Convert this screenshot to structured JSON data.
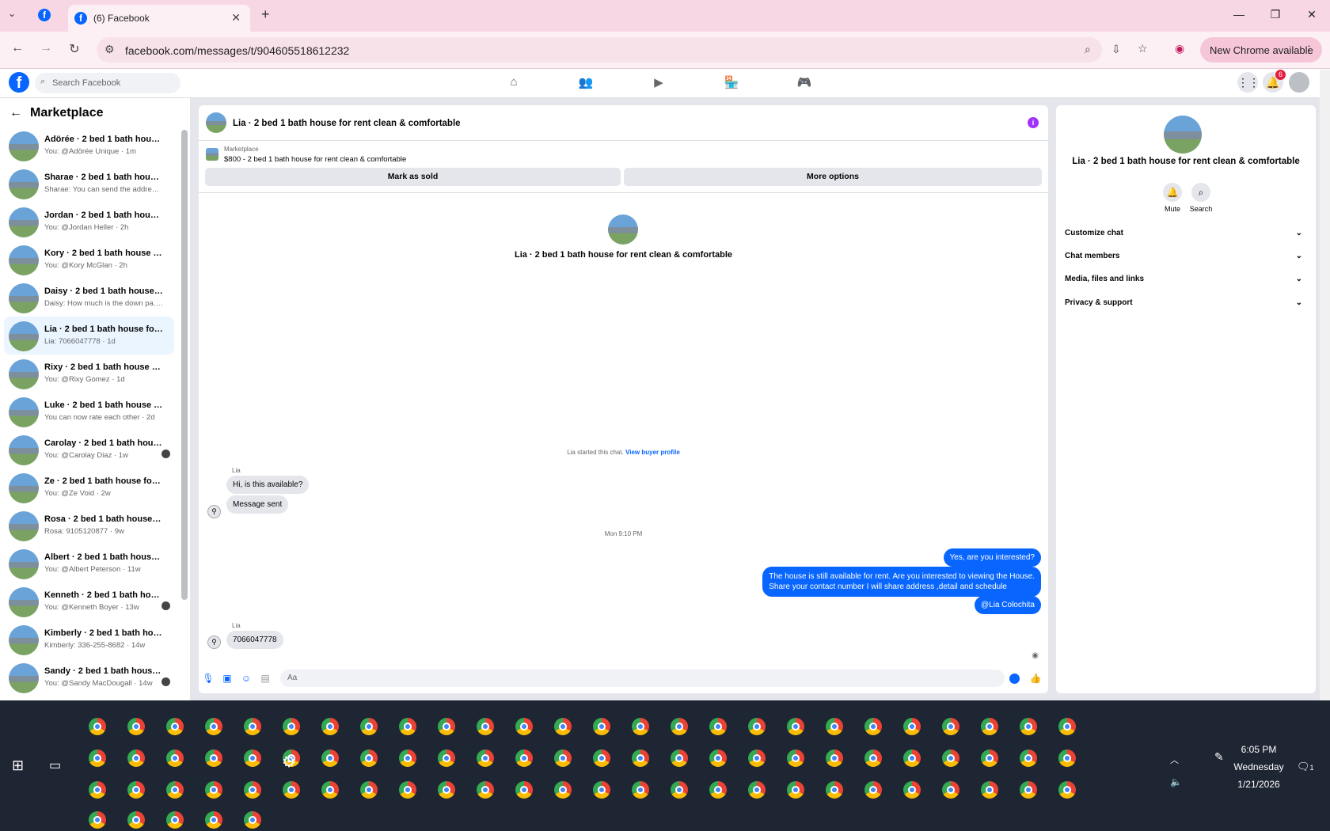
{
  "browser": {
    "tab_title": "(6) Facebook",
    "url": "facebook.com/messages/t/904605518612232",
    "new_chrome": "New Chrome available"
  },
  "fb": {
    "search_placeholder": "Search Facebook",
    "notification_count": "6"
  },
  "sidebar": {
    "title": "Marketplace",
    "conversations": [
      {
        "name": "Adörée · 2 bed 1 bath house fo...",
        "preview": "You: @Adörée Unique · 1m"
      },
      {
        "name": "Sharae · 2 bed 1 bath house for...",
        "preview": "Sharae: You can send the address ... · 2h"
      },
      {
        "name": "Jordan · 2 bed 1 bath house for...",
        "preview": "You: @Jordan Heller · 2h"
      },
      {
        "name": "Kory · 2 bed 1 bath house for r...",
        "preview": "You: @Kory McGlan · 2h"
      },
      {
        "name": "Daisy · 2 bed 1 bath house for r...",
        "preview": "Daisy: How much is the down pa... · 17h"
      },
      {
        "name": "Lia · 2 bed 1 bath house for ren...",
        "preview": "Lia: 7066047778 · 1d"
      },
      {
        "name": "Rixy · 2 bed 1 bath house for re...",
        "preview": "You: @Rixy Gomez · 1d"
      },
      {
        "name": "Luke · 2 bed 1 bath house for r...",
        "preview": "You can now rate each other · 2d"
      },
      {
        "name": "Carolay · 2 bed 1 bath house ...",
        "preview": "You: @Carolay Diaz · 1w"
      },
      {
        "name": "Ze · 2 bed 1 bath house for rent...",
        "preview": "You: @Ze Void · 2w"
      },
      {
        "name": "Rosa · 2 bed 1 bath house for r...",
        "preview": "Rosa: 9105120877 · 9w"
      },
      {
        "name": "Albert · 2 bed 1 bath house for ...",
        "preview": "You: @Albert Peterson · 11w"
      },
      {
        "name": "Kenneth · 2 bed 1 bath house...",
        "preview": "You: @Kenneth Boyer · 13w"
      },
      {
        "name": "Kimberly · 2 bed 1 bath house f...",
        "preview": "Kimberly: 336-255-8682 · 14w"
      },
      {
        "name": "Sandy · 2 bed 1 bath house f...",
        "preview": "You: @Sandy MacDougall · 14w"
      }
    ]
  },
  "chat": {
    "title": "Lia · 2 bed 1 bath house for rent clean & comfortable",
    "marketplace_label": "Marketplace",
    "listing": "$800 - 2 bed 1 bath house for rent clean & comfortable",
    "mark_sold": "Mark as sold",
    "more_options": "More options",
    "center_title": "Lia · 2 bed 1 bath house for rent clean & comfortable",
    "system_text": "Lia started this chat.",
    "system_link": "View buyer profile",
    "sender": "Lia",
    "msg1": "Hi, is this available?",
    "msg2": "Message sent",
    "timestamp": "Mon 9:10 PM",
    "out1": "Yes, are you interested?",
    "out2_line1": "The house is still available for rent. Are you interested to viewing  the House.",
    "out2_line2": "Share your contact number I will share address ,detail and schedule",
    "out3": "@Lia Colochita",
    "msg3": "7066047778",
    "composer_placeholder": "Aa"
  },
  "right": {
    "title": "Lia · 2 bed 1 bath house for rent clean & comfortable",
    "mute": "Mute",
    "search": "Search",
    "rows": [
      "Customize chat",
      "Chat members",
      "Media, files and links",
      "Privacy & support"
    ]
  },
  "taskbar": {
    "time": "6:05 PM",
    "day": "Wednesday",
    "date": "1/21/2026",
    "notif": "1"
  }
}
